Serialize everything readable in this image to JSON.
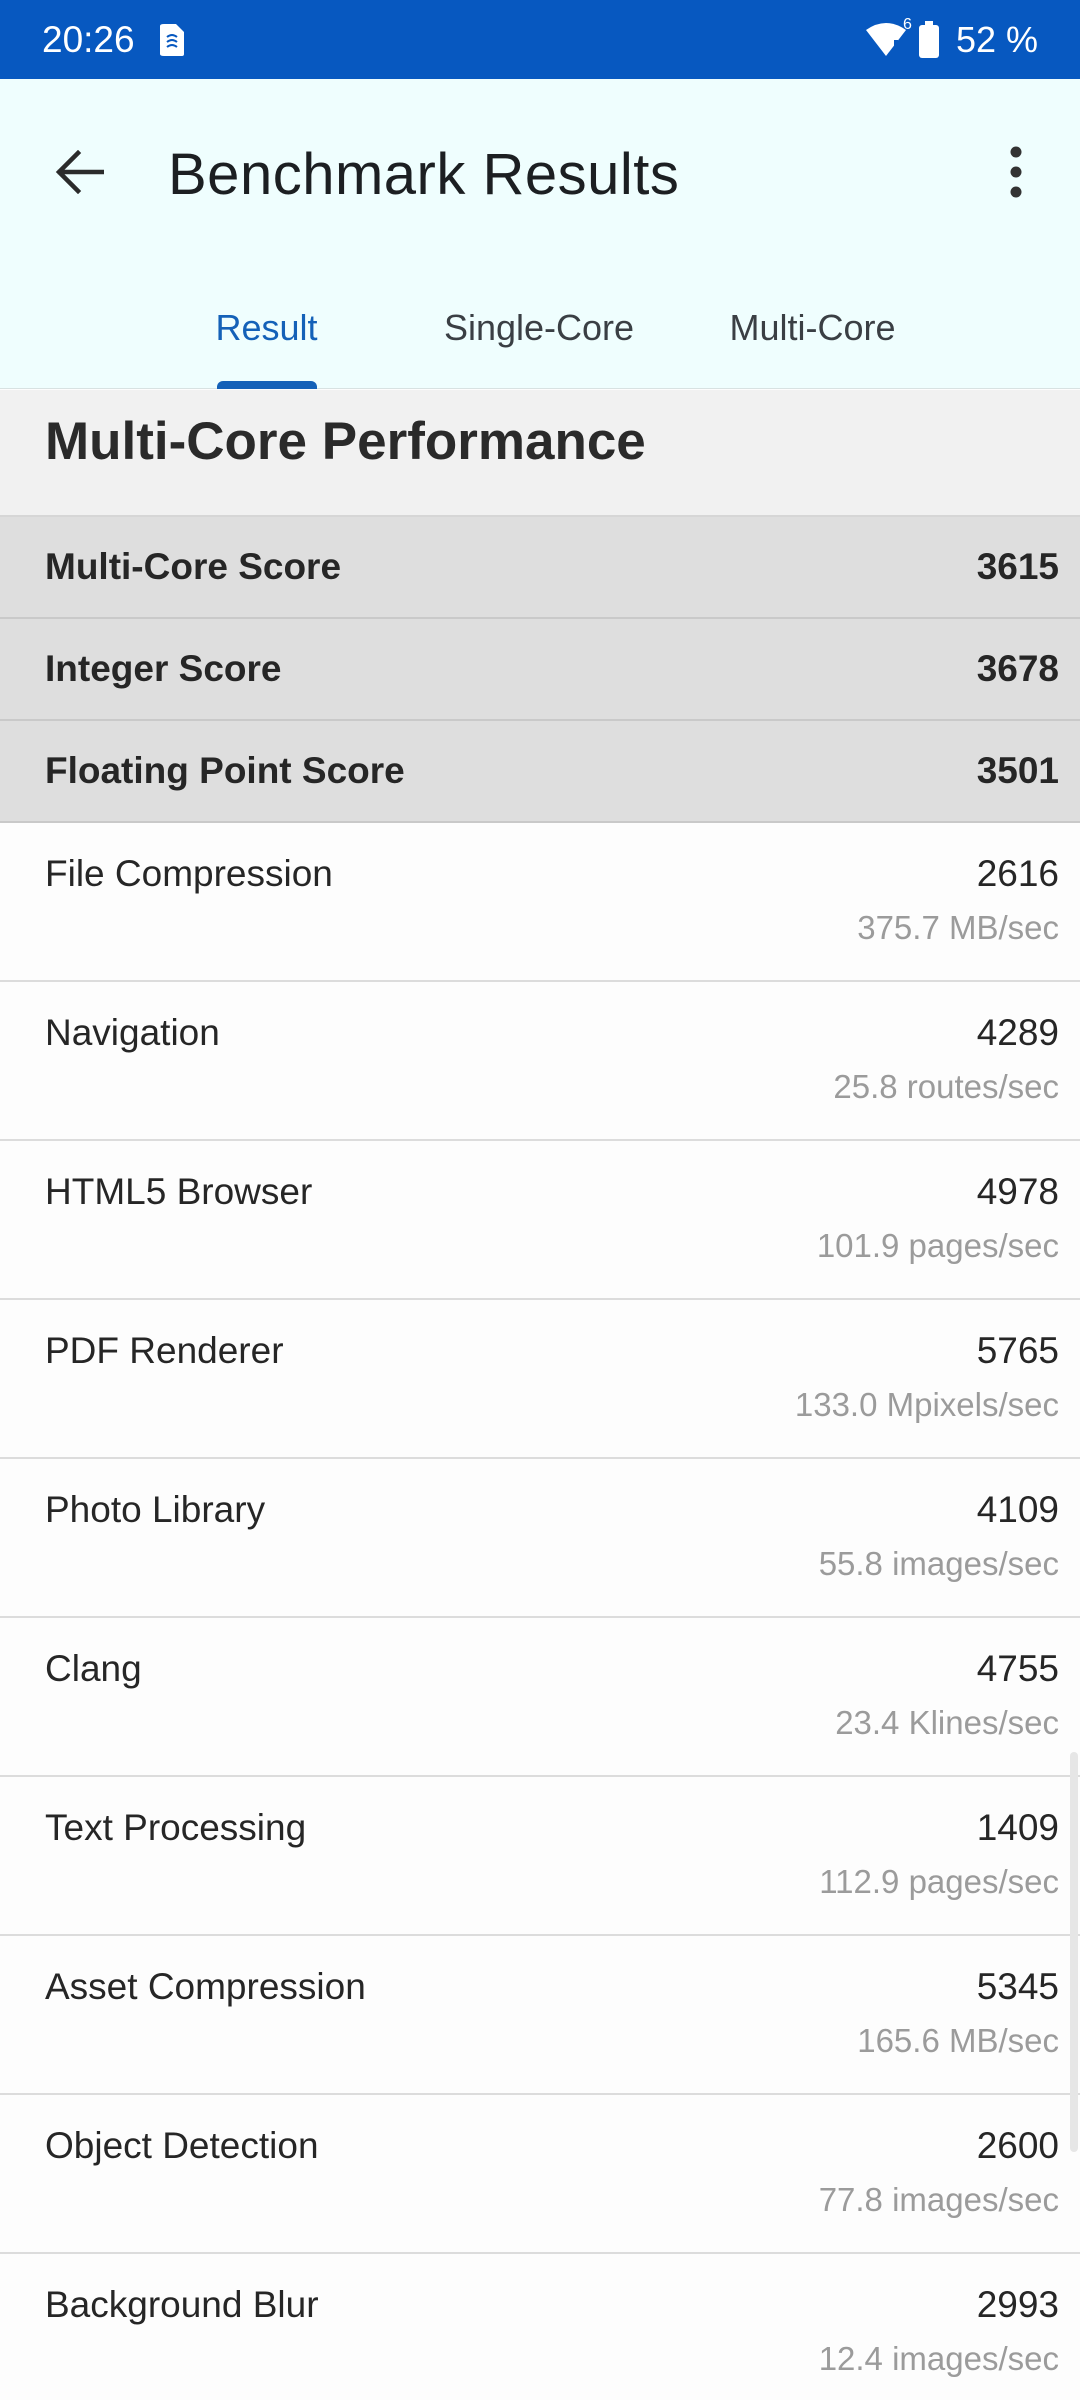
{
  "status_bar": {
    "time": "20:26",
    "battery_percent": "52 %",
    "signal_label": "6"
  },
  "app_bar": {
    "title": "Benchmark Results"
  },
  "tabs": [
    {
      "label": "Result",
      "active": true
    },
    {
      "label": "Single-Core",
      "active": false
    },
    {
      "label": "Multi-Core",
      "active": false
    }
  ],
  "section": {
    "title": "Multi-Core Performance"
  },
  "summary_scores": [
    {
      "label": "Multi-Core Score",
      "value": "3615"
    },
    {
      "label": "Integer Score",
      "value": "3678"
    },
    {
      "label": "Floating Point Score",
      "value": "3501"
    }
  ],
  "benchmarks": [
    {
      "name": "File Compression",
      "score": "2616",
      "rate": "375.7 MB/sec"
    },
    {
      "name": "Navigation",
      "score": "4289",
      "rate": "25.8 routes/sec"
    },
    {
      "name": "HTML5 Browser",
      "score": "4978",
      "rate": "101.9 pages/sec"
    },
    {
      "name": "PDF Renderer",
      "score": "5765",
      "rate": "133.0 Mpixels/sec"
    },
    {
      "name": "Photo Library",
      "score": "4109",
      "rate": "55.8 images/sec"
    },
    {
      "name": "Clang",
      "score": "4755",
      "rate": "23.4 Klines/sec"
    },
    {
      "name": "Text Processing",
      "score": "1409",
      "rate": "112.9 pages/sec"
    },
    {
      "name": "Asset Compression",
      "score": "5345",
      "rate": "165.6 MB/sec"
    },
    {
      "name": "Object Detection",
      "score": "2600",
      "rate": "77.8 images/sec"
    },
    {
      "name": "Background Blur",
      "score": "2993",
      "rate": "12.4 images/sec"
    }
  ],
  "colors": {
    "status_bar": "#0758c0",
    "app_bar": "#effefe",
    "accent": "#1461b8",
    "score_row": "#dedede",
    "section_header": "#f1f1f1"
  },
  "icons": {
    "back": "arrow-left-icon",
    "more": "more-vert-icon",
    "wifi": "wifi-icon",
    "battery": "battery-icon",
    "sim": "sim-card-icon"
  }
}
